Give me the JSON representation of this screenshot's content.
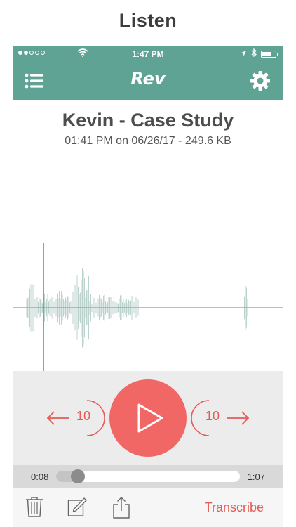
{
  "caption": "Listen",
  "status_bar": {
    "time": "1:47 PM",
    "signal_bars_filled": 2,
    "signal_bars_total": 5,
    "battery_level": 0.7
  },
  "nav": {
    "logo_text": "Rev",
    "menu_icon": "list-icon",
    "settings_icon": "gear-icon"
  },
  "recording": {
    "title": "Kevin - Case Study",
    "meta": "01:41 PM on 06/26/17 - 249.6 KB"
  },
  "player": {
    "skip_back_seconds": "10",
    "skip_forward_seconds": "10",
    "play_icon": "play-icon",
    "elapsed": "0:08",
    "duration": "1:07",
    "progress_fraction": 0.12
  },
  "toolbar": {
    "delete_icon": "trash-icon",
    "edit_icon": "edit-icon",
    "share_icon": "share-icon",
    "transcribe_label": "Transcribe"
  },
  "colors": {
    "header": "#5fa394",
    "accent": "#f06766",
    "accent_text": "#e45b57",
    "waveform": "#8fb3ab",
    "playhead": "#e45b57"
  }
}
